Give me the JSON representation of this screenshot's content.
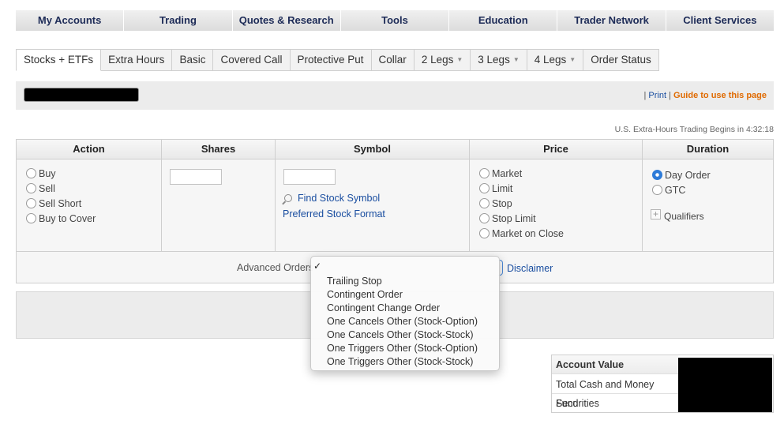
{
  "topnav": [
    "My Accounts",
    "Trading",
    "Quotes & Research",
    "Tools",
    "Education",
    "Trader Network",
    "Client Services"
  ],
  "subtabs": [
    {
      "label": "Stocks + ETFs",
      "active": true,
      "caret": false
    },
    {
      "label": "Extra Hours",
      "active": false,
      "caret": false
    },
    {
      "label": "Basic",
      "active": false,
      "caret": false
    },
    {
      "label": "Covered Call",
      "active": false,
      "caret": false
    },
    {
      "label": "Protective Put",
      "active": false,
      "caret": false
    },
    {
      "label": "Collar",
      "active": false,
      "caret": false
    },
    {
      "label": "2 Legs",
      "active": false,
      "caret": true
    },
    {
      "label": "3 Legs",
      "active": false,
      "caret": true
    },
    {
      "label": "4 Legs",
      "active": false,
      "caret": true
    },
    {
      "label": "Order Status",
      "active": false,
      "caret": false
    }
  ],
  "toolbar": {
    "separator": "|",
    "print": "Print",
    "guide": "Guide to use this page"
  },
  "extra_hours_notice": "U.S. Extra-Hours Trading Begins in 4:32:18",
  "table": {
    "headers": [
      "Action",
      "Shares",
      "Symbol",
      "Price",
      "Duration"
    ],
    "action_options": [
      "Buy",
      "Sell",
      "Sell Short",
      "Buy to Cover"
    ],
    "find_symbol": "Find Stock Symbol",
    "preferred_format": "Preferred Stock Format",
    "price_options": [
      "Market",
      "Limit",
      "Stop",
      "Stop Limit",
      "Market on Close"
    ],
    "duration_options": [
      {
        "label": "Day Order",
        "checked": true
      },
      {
        "label": "GTC",
        "checked": false
      }
    ],
    "qualifiers": "Qualifiers",
    "advanced_label": "Advanced Orders",
    "disclaimer": "Disclaimer"
  },
  "dropdown": {
    "check": "✓",
    "options": [
      "Trailing Stop",
      "Contingent Order",
      "Contingent Change Order",
      "One Cancels Other (Stock-Option)",
      "One Cancels Other (Stock-Stock)",
      "One Triggers Other (Stock-Option)",
      "One Triggers Other (Stock-Stock)"
    ]
  },
  "account": {
    "header": "Account Value",
    "rows": [
      "Total Cash and Money Fund",
      "Securities"
    ]
  },
  "colors": {
    "nav_text": "#1d2b57",
    "link": "#1a4ea0",
    "guide": "#e06a00",
    "radio_checked": "#2d7bd8"
  },
  "icons": {
    "find": "magnifier-icon",
    "qualifiers": "plus-box-icon",
    "check": "checkmark-icon",
    "tab_caret": "caret-down-icon"
  }
}
